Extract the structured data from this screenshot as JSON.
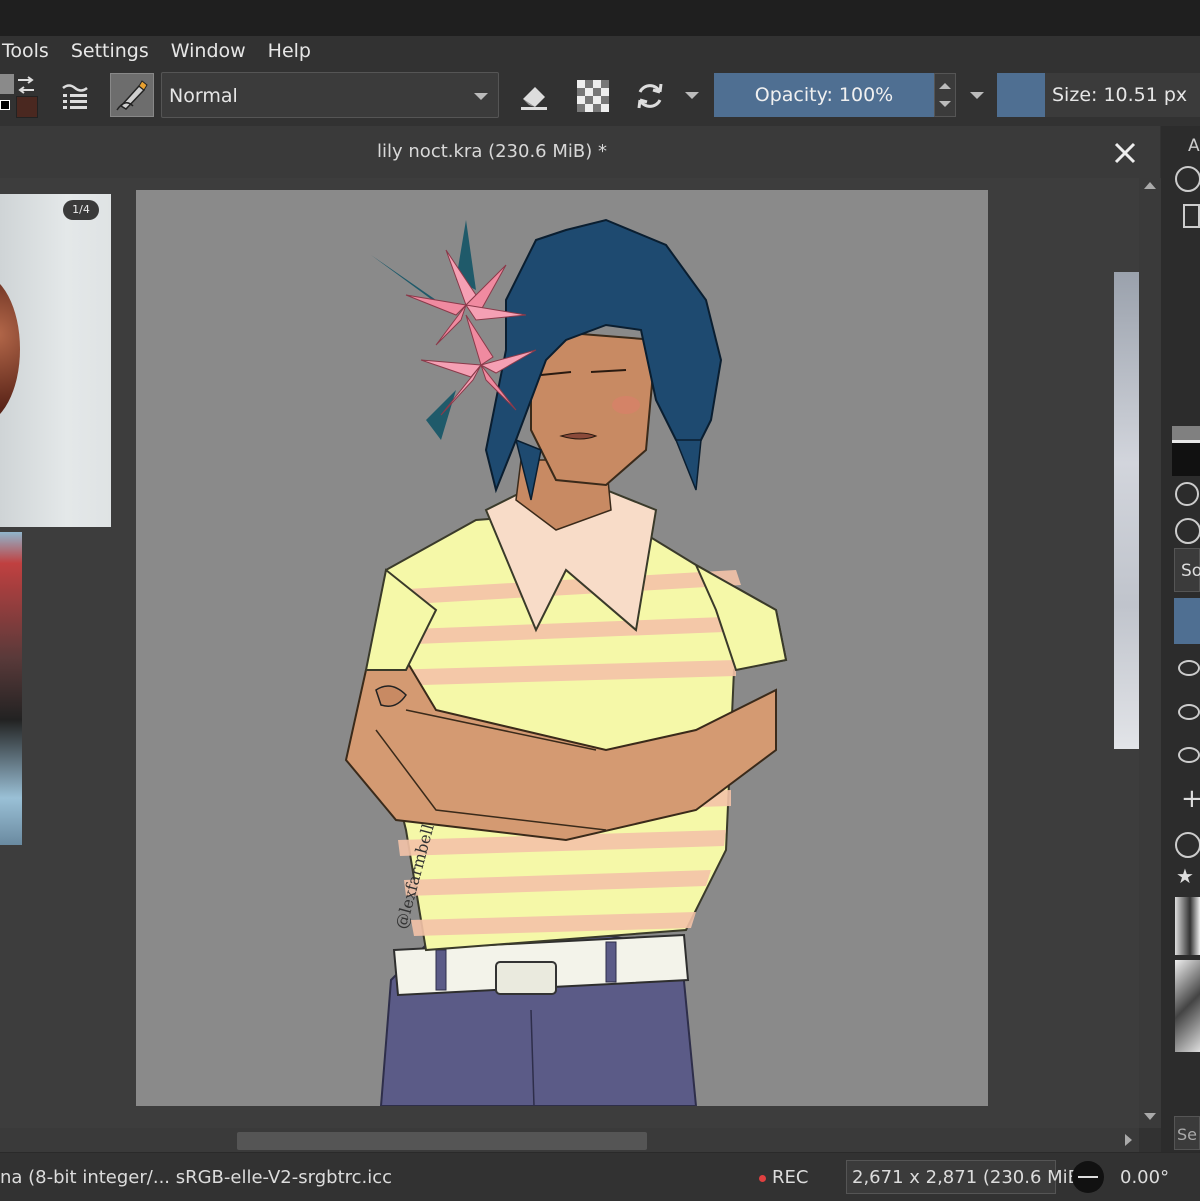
{
  "menu": {
    "items": [
      "Tools",
      "Settings",
      "Window",
      "Help"
    ]
  },
  "toolbar": {
    "blend_mode": "Normal",
    "opacity_label": "Opacity: 100%",
    "opacity_value_percent": 100,
    "size_label": "Size: 10.51 px"
  },
  "document": {
    "title": "lily noct.kra (230.6 MiB) *",
    "reference_counter": "1/4",
    "signature": "@lexfarmbell"
  },
  "status": {
    "color_profile": "na (8-bit integer/... sRGB-elle-V2-srgbtrc.icc",
    "rec_label": "REC",
    "dimensions": "2,671 x 2,871 (230.6 MiB)",
    "rotation": "0.00°"
  },
  "dock": {
    "tab_letter": "A",
    "field_stub": "So",
    "search_stub": "Se"
  },
  "colors": {
    "accent": "#4f6f92",
    "canvas_bg": "#8a8a8a",
    "rec_dot": "#e04040"
  }
}
